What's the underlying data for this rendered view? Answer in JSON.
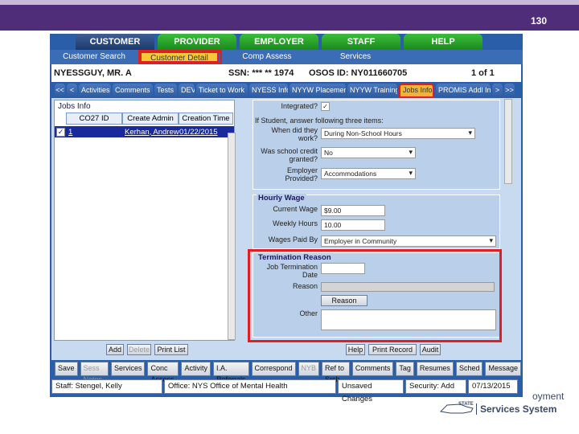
{
  "slide": {
    "number": "130"
  },
  "main_tabs": [
    "CUSTOMER",
    "PROVIDER",
    "EMPLOYER",
    "STAFF",
    "HELP"
  ],
  "sub_tabs": [
    "Customer Search",
    "Customer Detail",
    "Comp Assess",
    "Services"
  ],
  "customer": {
    "name": "NYESSGUY, MR. A",
    "ssn": "SSN: *** ** 1974",
    "osos": "OSOS ID: NY011660705",
    "count": "1 of 1"
  },
  "detail_tabs": [
    "<<",
    "<",
    "Activities",
    "Comments",
    "Tests",
    "DEV",
    "Ticket to Work",
    "NYESS Info",
    "NYYW Placement",
    "NYYW Training",
    "Jobs Info",
    "PROMIS Addl Info",
    ">",
    ">>"
  ],
  "jobs": {
    "title": "Jobs Info",
    "columns": [
      "CO27 ID",
      "Create Admin",
      "Creation Time"
    ],
    "rows": [
      {
        "id": "1",
        "admin": "Kerhan, Andrew",
        "time": "01/22/2015"
      }
    ],
    "buttons": {
      "add": "Add",
      "delete": "Delete",
      "print": "Print List"
    }
  },
  "form": {
    "integrated_label": "Integrated?",
    "student_note": "If Student, answer following three items:",
    "when_label": "When did they work?",
    "when_value": "During Non-School Hours",
    "credit_label": "Was school credit granted?",
    "credit_value": "No",
    "employer_label": "Employer Provided?",
    "employer_value": "Accommodations",
    "hourly_title": "Hourly Wage",
    "current_wage_label": "Current Wage",
    "current_wage_value": "$9.00",
    "weekly_hours_label": "Weekly Hours",
    "weekly_hours_value": "10.00",
    "paid_by_label": "Wages Paid By",
    "paid_by_value": "Employer in Community",
    "termination_title": "Termination Reason",
    "term_date_label": "Job Termination Date",
    "reason_label": "Reason",
    "reason_button": "Reason",
    "other_label": "Other",
    "help": "Help",
    "print_record": "Print Record",
    "audit": "Audit"
  },
  "bottom_buttons": [
    "Save",
    "Sess Notes",
    "Services",
    "Conc Assess",
    "Activity",
    "I.A. Referrals",
    "Correspond",
    "NYB",
    "Ref to Srch",
    "Comments",
    "Tag",
    "Resumes",
    "Sched",
    "Message"
  ],
  "status": {
    "staff": "Staff: Stengel, Kelly",
    "office": "Office: NYS Office of Mental Health",
    "unsaved": "Unsaved Changes",
    "security": "Security: Add",
    "date": "07/13/2015"
  },
  "logo": {
    "top": "oyment",
    "state": "STATE",
    "services": "Services System"
  }
}
